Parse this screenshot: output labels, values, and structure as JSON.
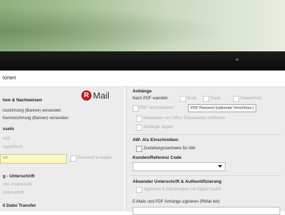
{
  "window": {
    "title": "ionen"
  },
  "left": {
    "section1_title": "hen & Nachweisen",
    "logo_text": "Mail",
    "logo_letter": "R",
    "opt1": "nzeichnung (Banner) versenden",
    "opt2": "Kennzeichnung (Banner) versenden",
    "section2_title": "sseln",
    "opt3": "isch",
    "opt4": "sspezifisch",
    "yellow_value": "ort",
    "email_pw_label": "Passwort e-mailen",
    "section3_title": "g - Unterschrift",
    "opt5": "che Unterschrift",
    "opt6": "Unterschrift",
    "section4_title": "il Datei Transfer"
  },
  "right": {
    "attachments_title": "Anhänge",
    "convert_label": "Nach PDF wandeln",
    "word": "Word",
    "excel": "Excel",
    "powerpoint": "PowerPoint",
    "pdf_encrypt": "PDF verschlüsseln",
    "pdf_password_button": "PDF Passwort (optionale Verschlüss.)",
    "metadata": "Metadaten von Office Dokumenten entfernen",
    "zip": "Anhänge zippen",
    "aw_title": "AW: Als Einschreiben",
    "aw_opt": "Zustellungsnachweis für AW:",
    "client_title": "Kunden/Referenz Code",
    "sender_title": "Absender Unterschrift & Authentifizierung",
    "sender_opt": "Signieren & Zeitstempeln mit Digital Seal®",
    "esign_label": "E-Mails und PDF Anhänge signieren (RMail Ink)"
  }
}
